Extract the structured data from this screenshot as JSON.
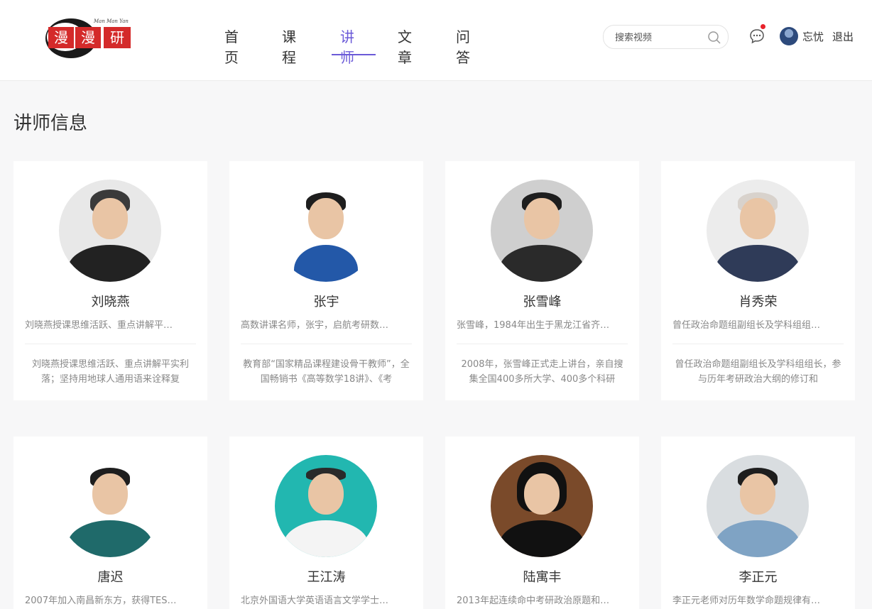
{
  "header": {
    "logo_alt": "漫漫研",
    "logo_tag": "Man Man Yan",
    "nav": [
      {
        "label": "首页",
        "active": false
      },
      {
        "label": "课程",
        "active": false
      },
      {
        "label": "讲师",
        "active": true
      },
      {
        "label": "文章",
        "active": false
      },
      {
        "label": "问答",
        "active": false
      }
    ],
    "search_placeholder": "搜索视频",
    "username": "忘忧",
    "logout": "退出",
    "accent_color": "#6b5ad8",
    "notification_dot_color": "#e8232b"
  },
  "section_title": "讲师信息",
  "teachers": [
    {
      "name": "刘晓燕",
      "short": "刘晓燕授课思维活跃、重点讲解平…",
      "long": "刘晓燕授课思维活跃、重点讲解平实利落；坚持用地球人通用语来诠释复"
    },
    {
      "name": "张宇",
      "short": "高数讲课名师，张宇，启航考研数…",
      "long": "教育部“国家精品课程建设骨干教师”，全国畅销书《高等数学18讲》、《考"
    },
    {
      "name": "张雪峰",
      "short": "张雪峰，1984年出生于黑龙江省齐…",
      "long": "2008年，张雪峰正式走上讲台，亲自搜集全国400多所大学、400多个科研"
    },
    {
      "name": "肖秀荣",
      "short": "曾任政治命题组副组长及学科组组…",
      "long": "曾任政治命题组副组长及学科组组长，参与历年考研政治大纲的修订和"
    },
    {
      "name": "唐迟",
      "short": "2007年加入南昌新东方，获得TES…",
      "long": ""
    },
    {
      "name": "王江涛",
      "short": "北京外国语大学英语语言文学学士…",
      "long": ""
    },
    {
      "name": "陆寓丰",
      "short": "2013年起连续命中考研政治原题和…",
      "long": ""
    },
    {
      "name": "李正元",
      "short": "李正元老师对历年数学命题规律有…",
      "long": ""
    }
  ]
}
